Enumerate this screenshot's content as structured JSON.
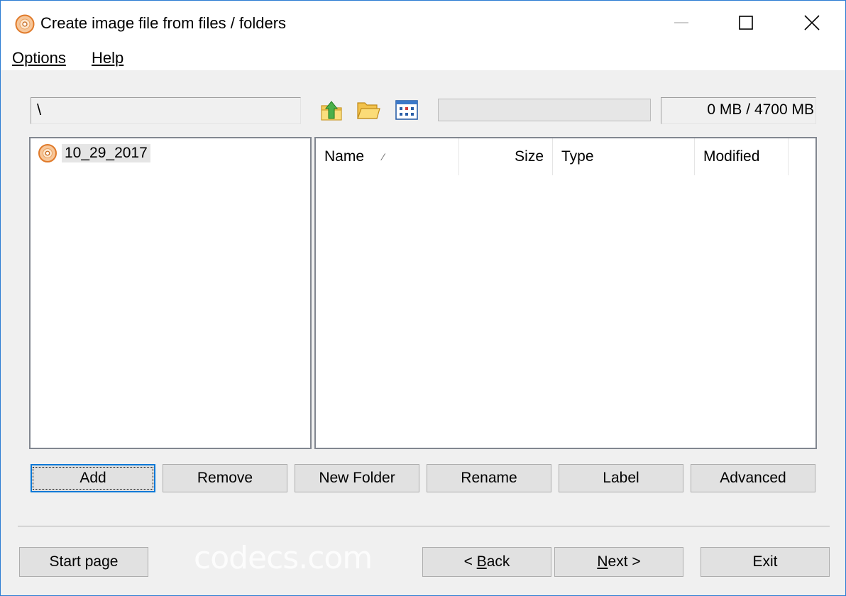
{
  "window": {
    "title": "Create image file from files / folders"
  },
  "menu": {
    "options": "Options",
    "help": "Help"
  },
  "toolbar": {
    "path": "\\",
    "capacity": "0 MB / 4700 MB",
    "progress_fraction": 0,
    "icons": [
      "folder-up-icon",
      "open-folder-icon",
      "view-icon"
    ]
  },
  "tree": {
    "items": [
      {
        "label": "10_29_2017",
        "icon": "disc-icon"
      }
    ]
  },
  "file_list": {
    "columns": [
      "Name",
      "Size",
      "Type",
      "Modified"
    ],
    "sort_indicator": "∕",
    "rows": []
  },
  "actions": {
    "add": "Add",
    "remove": "Remove",
    "new_folder": "New Folder",
    "rename": "Rename",
    "label": "Label",
    "advanced": "Advanced"
  },
  "nav": {
    "start_page": "Start page",
    "back_prefix": "< ",
    "back_key": "B",
    "back_rest": "ack",
    "next_key": "N",
    "next_rest": "ext >",
    "exit": "Exit"
  },
  "watermark": "codecs.com",
  "colors": {
    "accent": "#0078d7",
    "window_border": "#2b7cd3"
  }
}
